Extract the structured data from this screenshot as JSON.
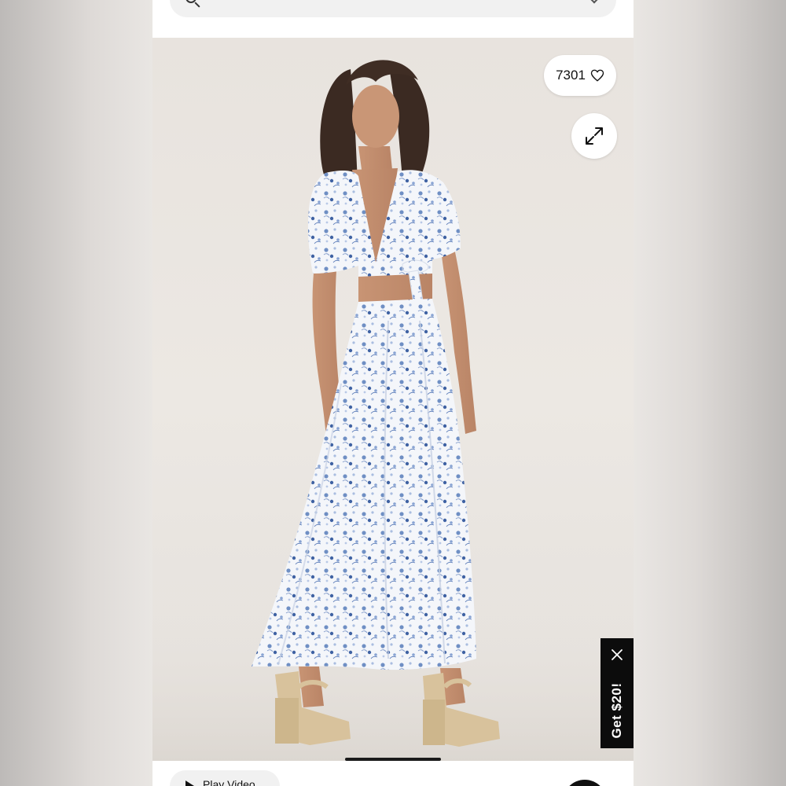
{
  "search": {
    "icon": "search-icon",
    "chevron": "chevron-down-icon"
  },
  "product": {
    "likes_count": "7301",
    "like_icon": "heart-icon",
    "expand_icon": "expand-icon"
  },
  "promo": {
    "label": "Get $20!",
    "close_icon": "close-icon"
  },
  "bottom": {
    "play_video_label": "Play Video",
    "play_icon": "play-icon"
  }
}
